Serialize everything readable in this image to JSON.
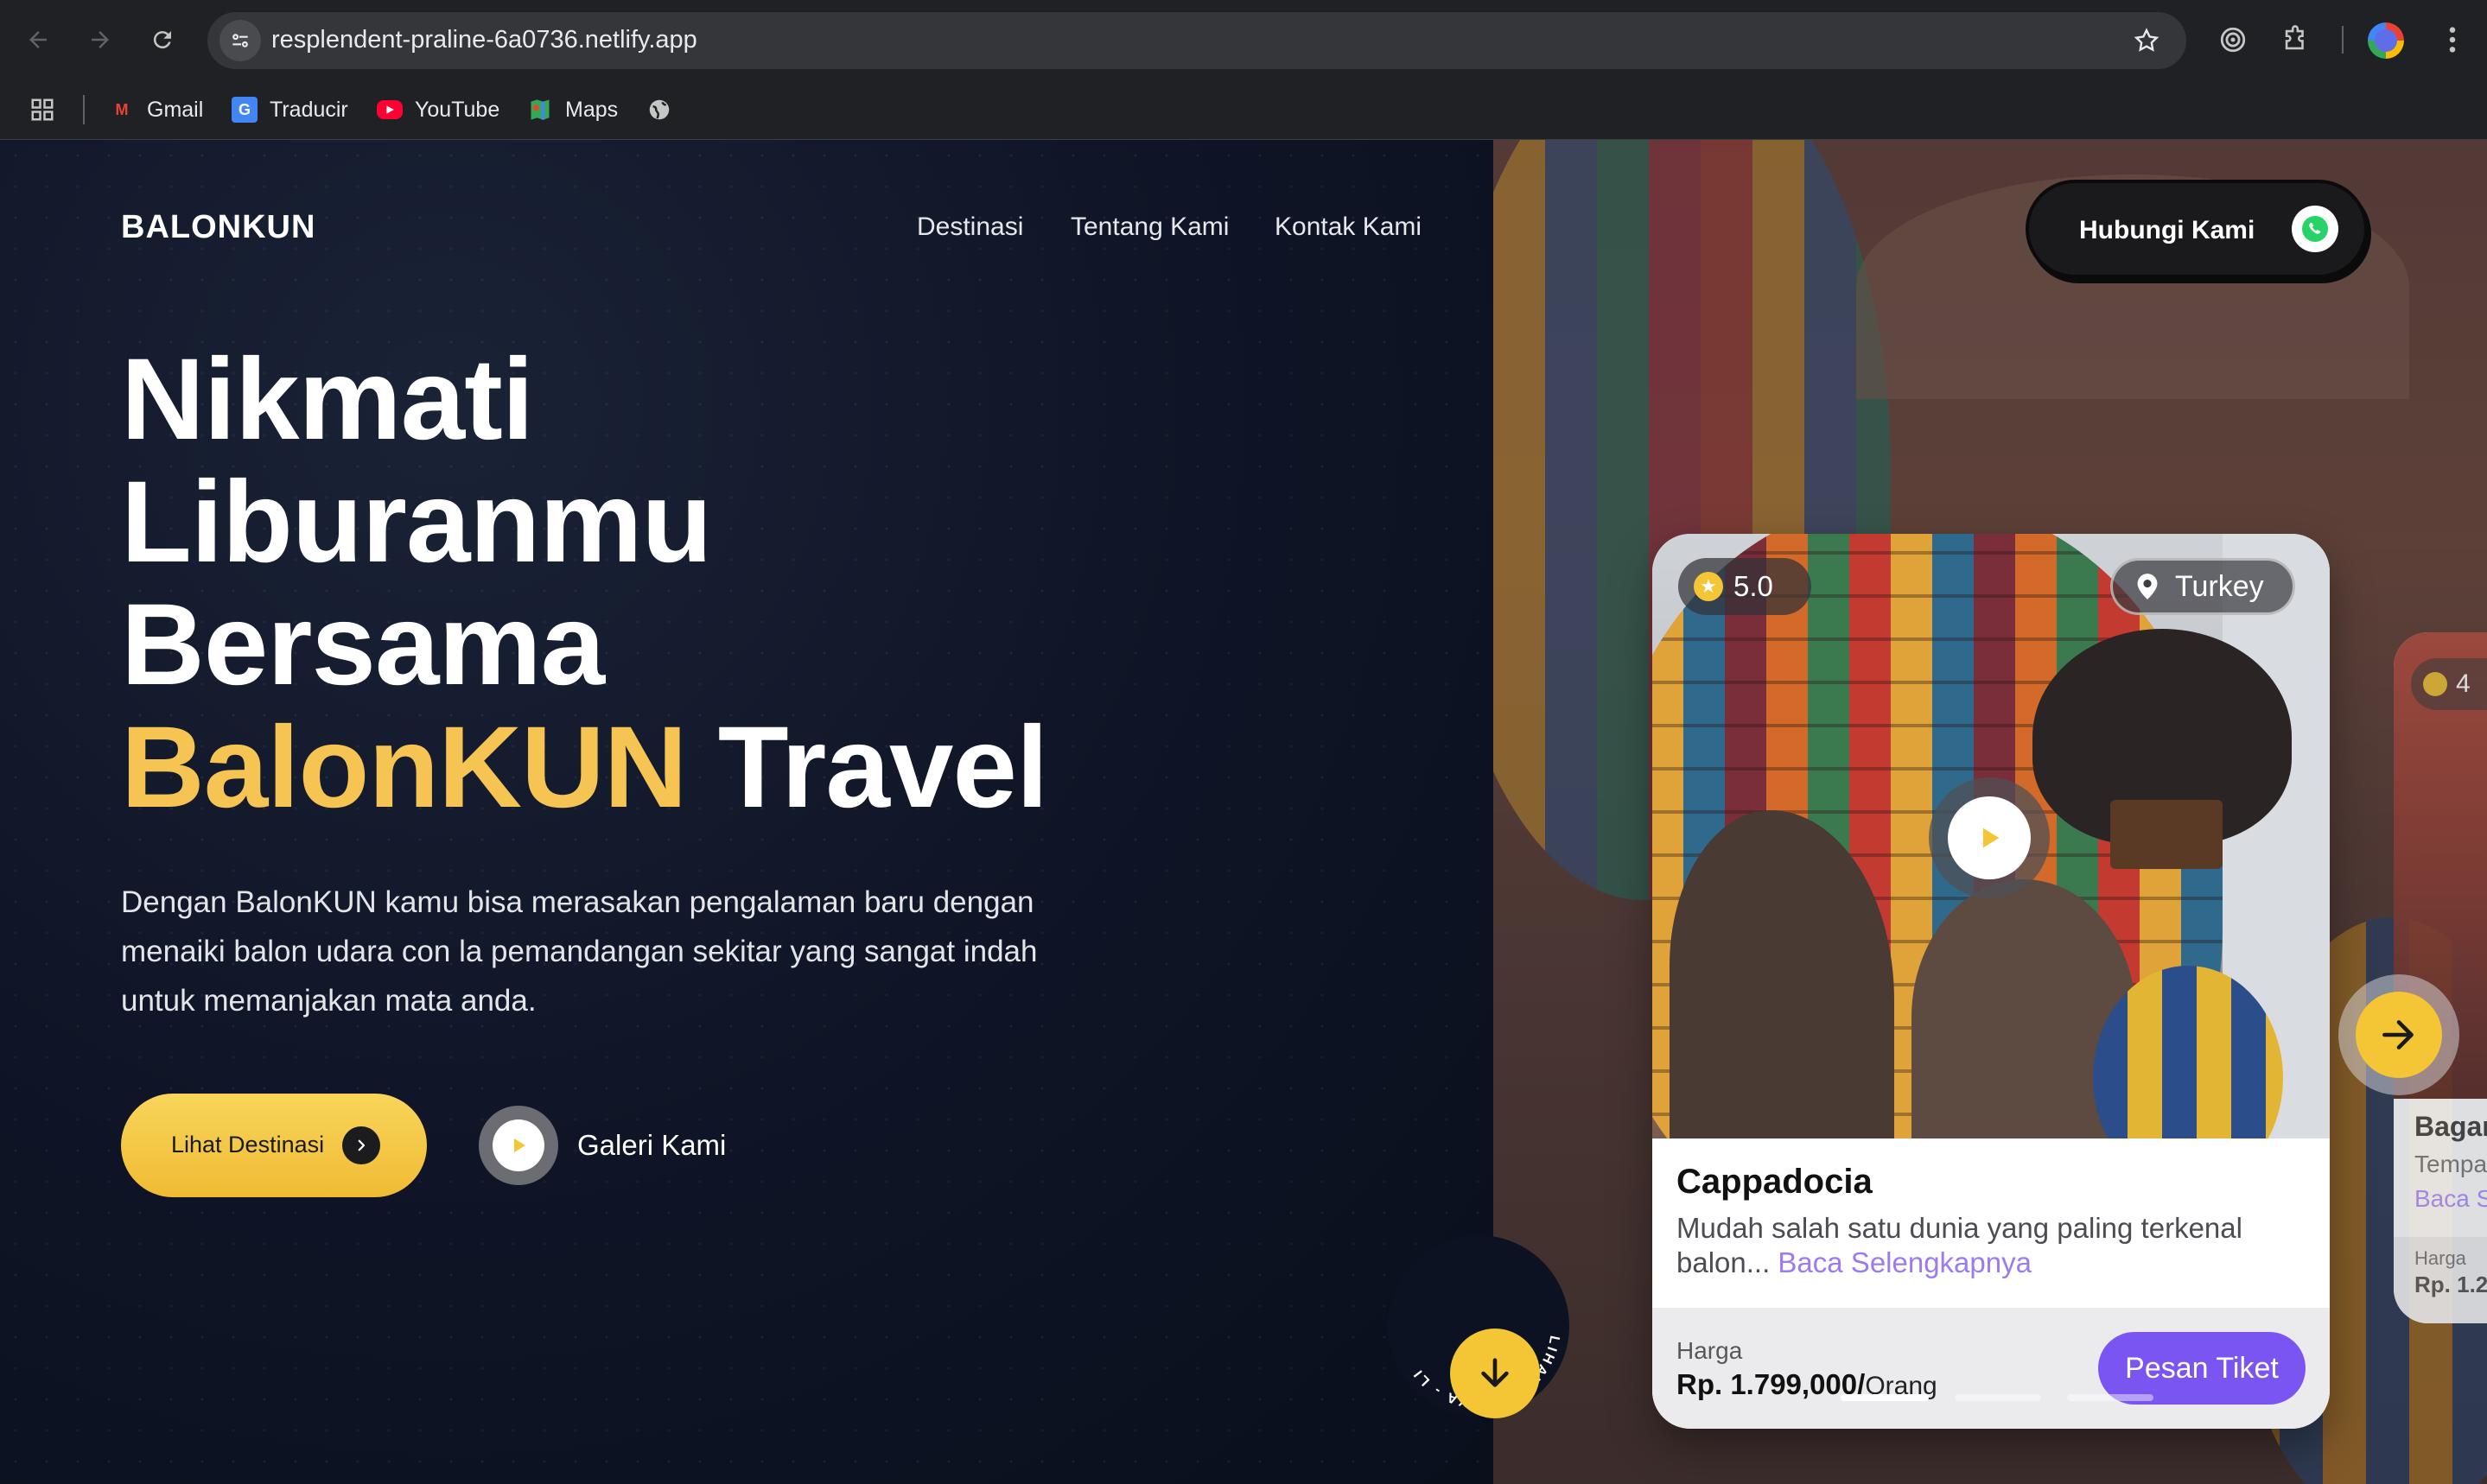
{
  "browser": {
    "url": "resplendent-praline-6a0736.netlify.app",
    "bookmarks": [
      {
        "label": "Gmail",
        "icon": "gmail-icon"
      },
      {
        "label": "Traducir",
        "icon": "translate-icon"
      },
      {
        "label": "YouTube",
        "icon": "youtube-icon"
      },
      {
        "label": "Maps",
        "icon": "maps-icon"
      }
    ]
  },
  "header": {
    "brand": "BALONKUN",
    "nav": [
      "Destinasi",
      "Tentang Kami",
      "Kontak Kami"
    ],
    "contact_label": "Hubungi Kami"
  },
  "hero": {
    "title_line1": "Nikmati",
    "title_line2": "Liburanmu",
    "title_line3": "Bersama",
    "title_highlight": "BalonKUN",
    "title_rest": " Travel",
    "description": "Dengan BalonKUN kamu bisa merasakan pengalaman baru dengan menaiki balon udara con la pemandangan sekitar yang sangat indah untuk memanjakan mata anda.",
    "cta_label": "Lihat Destinasi",
    "gallery_label": "Galeri Kami",
    "scroll_badge_text": "LIHAT LAINNYA - LI"
  },
  "card": {
    "rating": "5.0",
    "location": "Turkey",
    "title": "Cappadocia",
    "description": "Mudah salah satu dunia yang paling terkenal balon...",
    "read_more": "Baca Selengkapnya",
    "price_label": "Harga",
    "price_value": "Rp. 1.799,000/",
    "price_unit": "Orang",
    "buy_label": "Pesan Tiket"
  },
  "peek_card": {
    "rating": "4",
    "title": "Bagan",
    "subtitle": "Tempat",
    "read_more": "Baca S",
    "price_label": "Harga",
    "price_value": "Rp. 1.2"
  },
  "carousel": {
    "pages": 3,
    "active": 1
  },
  "colors": {
    "accent_yellow": "#f6c453",
    "purple": "#7b55f2",
    "link_purple": "#9b7af2",
    "background_dark": "#0d1222"
  }
}
